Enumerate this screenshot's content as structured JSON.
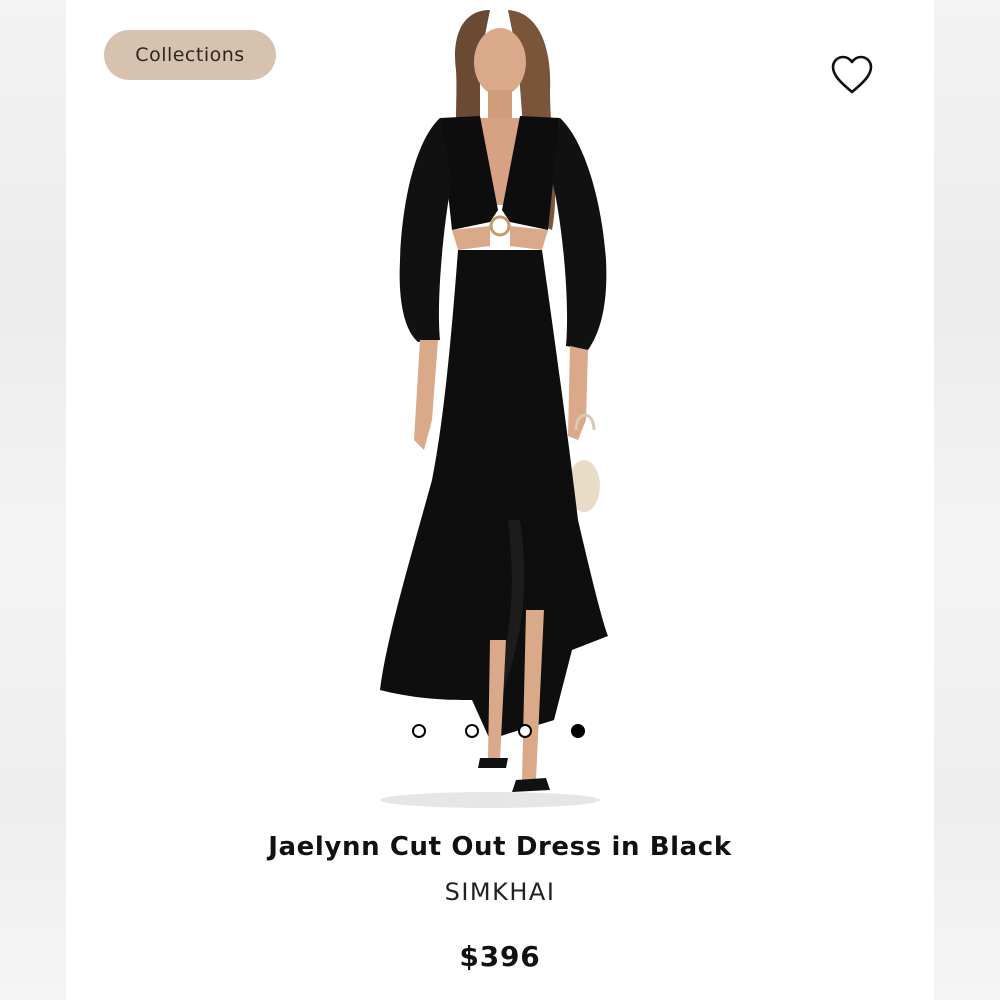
{
  "header": {
    "collections_label": "Collections"
  },
  "icons": {
    "favorite": "heart-outline-icon"
  },
  "gallery": {
    "image_description_name": "product-photo-black-cutout-dress",
    "slides_total": 4,
    "active_slide": 4
  },
  "product": {
    "title": "Jaelynn Cut Out Dress in Black",
    "brand": "SIMKHAI",
    "price": "$396"
  },
  "colors": {
    "chip_bg": "#d7c2b0",
    "dress": "#0d0d0d",
    "skin": "#d9a98a",
    "hair": "#6b4a33"
  }
}
